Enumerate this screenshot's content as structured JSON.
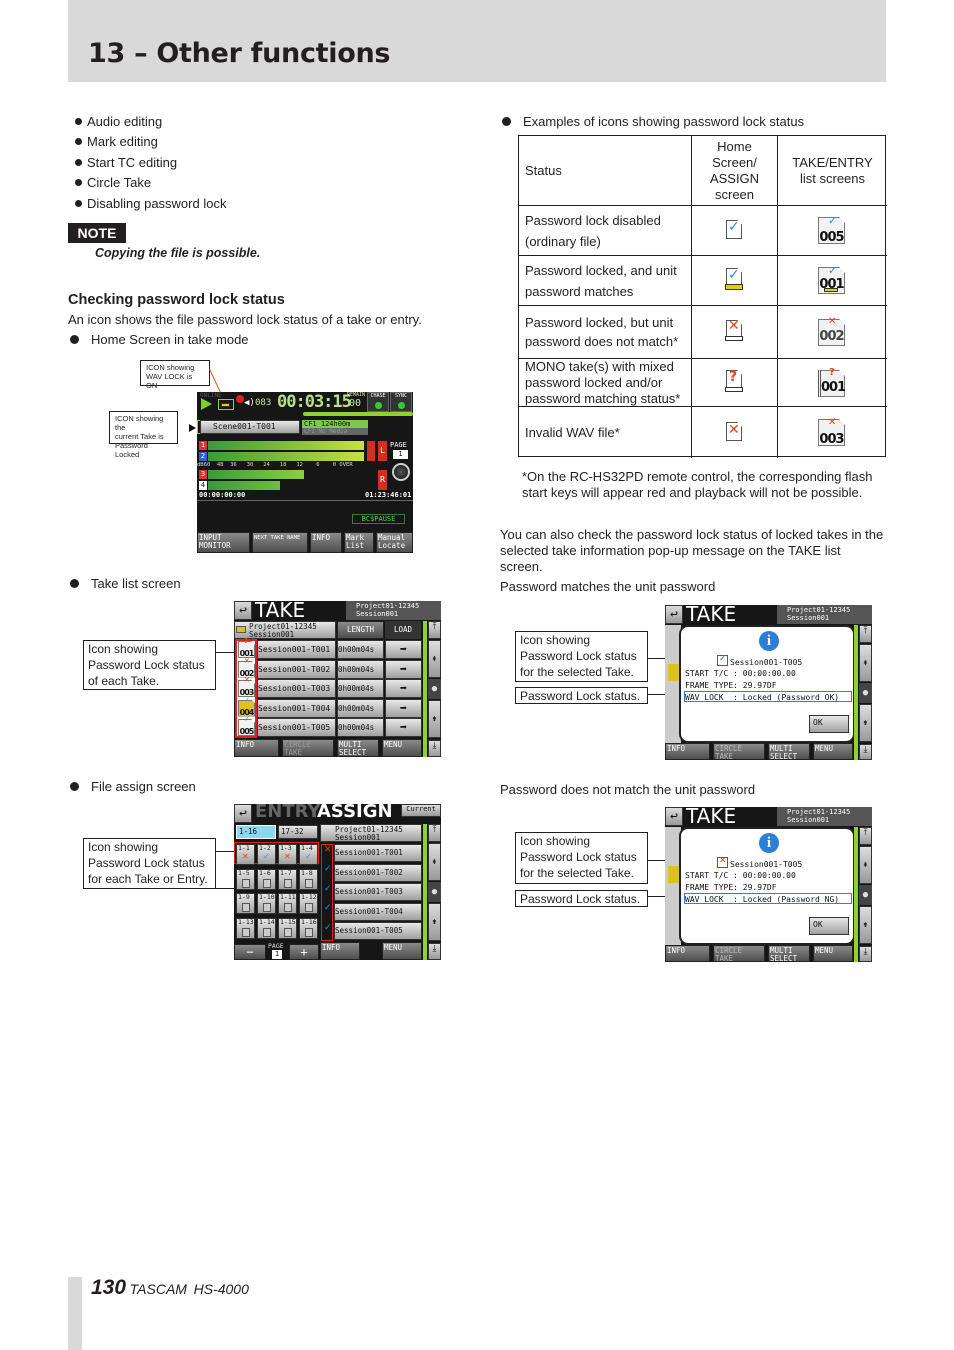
{
  "header": {
    "title": "13 – Other functions"
  },
  "left": {
    "bullets": [
      "Audio editing",
      "Mark editing",
      "Start TC editing",
      "Circle Take",
      "Disabling password lock"
    ],
    "note": {
      "label": "NOTE",
      "text": "Copying the file is possible."
    },
    "checking": {
      "heading": "Checking password lock status",
      "intro": "An icon shows the file password lock status of a take or entry.",
      "home_label": "Home Screen in take mode",
      "take_list_label": "Take list screen",
      "file_assign_label": "File assign screen"
    }
  },
  "home_screen": {
    "callout_wav": "ICON showing\nWAV LOCK is ON",
    "callout_take": "ICON showing the\ncurrent Take is\nPassword Locked",
    "online": "ONLINE",
    "counter": "083",
    "time": "00:03:15",
    "remain": "REMAIN",
    "frames": "00",
    "chase": "CHASE",
    "sync": "SYNC",
    "take_name": "Scene001-T001",
    "cf1": "CF1 124h00m",
    "cf2": "CF2 No Media",
    "channels": [
      "1",
      "2",
      "3",
      "4"
    ],
    "scale": "dB60  48  36   30   24   18   12    6    0 OVER",
    "left_label": "L",
    "right_label": "R",
    "page_label": "PAGE",
    "page_num": "1",
    "tc_start": "00:00:00:00",
    "tc_end": "01:23:46:01",
    "status": "BC$PAUSE",
    "buttons": [
      "INPUT MONITOR",
      "NEXT TAKE NAME",
      "INFO",
      "Mark List",
      "Manual Locate"
    ]
  },
  "take_list": {
    "callout": "Icon showing\nPassword Lock status\nof each Take.",
    "title": "TAKE",
    "project": "Project01-12345",
    "session": "Session001",
    "col_length": "LENGTH",
    "col_load": "LOAD",
    "rows": [
      {
        "num": "001",
        "name": "Session001-T001",
        "length": "0h00m04s",
        "icon": "mixed"
      },
      {
        "num": "002",
        "name": "Session001-T002",
        "length": "0h00m04s",
        "icon": "locked-mismatch"
      },
      {
        "num": "003",
        "name": "Session001-T003",
        "length": "0h00m04s",
        "icon": "invalid"
      },
      {
        "num": "004",
        "name": "Session001-T004",
        "length": "0h00m04s",
        "icon": "selected-locked"
      },
      {
        "num": "005",
        "name": "Session001-T005",
        "length": "0h00m04s",
        "icon": "unlocked"
      }
    ],
    "buttons": [
      "INFO",
      "CIRCLE TAKE",
      "MULTI SELECT",
      "MENU"
    ]
  },
  "assign": {
    "callout": "Icon showing\nPassword Lock status\nfor each Take or Entry.",
    "title_entry": "ENTRY",
    "title_assign": "ASSIGN",
    "current": "Current",
    "tabs": [
      "1-16",
      "17-32"
    ],
    "slots": [
      "1-1",
      "1-2",
      "1-3",
      "1-4",
      "1-5",
      "1-6",
      "1-7",
      "1-8",
      "1-9",
      "1-10",
      "1-11",
      "1-12",
      "1-13",
      "1-14",
      "1-15",
      "1-16"
    ],
    "project": "Project01-12345",
    "session": "Session001",
    "takes": [
      "Session001-T001",
      "Session001-T002",
      "Session001-T003",
      "Session001-T004",
      "Session001-T005"
    ],
    "minus": "−",
    "plus": "+",
    "page_label": "PAGE",
    "page_num": "1",
    "info": "INFO",
    "menu": "MENU"
  },
  "right": {
    "examples_heading": "Examples of icons showing password lock status",
    "table": {
      "headers": [
        "Status",
        "Home Screen/ ASSIGN screen",
        "TAKE/ENTRY list screens"
      ],
      "rows": [
        {
          "status": "Password lock disabled (ordinary file)",
          "num": "005"
        },
        {
          "status": "Password locked, and unit password matches",
          "num": "001"
        },
        {
          "status": "Password locked, but unit password does not match*",
          "num": "002"
        },
        {
          "status": "MONO take(s) with mixed password locked and/or password matching status*",
          "num": "001"
        },
        {
          "status": "Invalid WAV file*",
          "num": "003"
        }
      ]
    },
    "footnote": "*On the RC-HS32PD remote control, the corresponding flash start keys will appear red and playback will not be possible.",
    "para": "You can also check the password lock status of locked takes in the selected take information pop-up message on the TAKE list screen.",
    "match_label": "Password matches the unit password",
    "nomatch_label": "Password does not match the unit password"
  },
  "popup_ok": {
    "callout_icon": "Icon showing\nPassword Lock status\nfor the selected Take.",
    "callout_status": "Password Lock status.",
    "title": "TAKE",
    "project": "Project01-12345",
    "session": "Session001",
    "file": "Session001-T005",
    "start": "START T/C : 00:00:00.00",
    "frame": "FRAME TYPE: 29.97DF",
    "wav": "WAV LOCK  : Locked (Password OK)",
    "ok": "OK",
    "buttons": [
      "INFO",
      "CIRCLE TAKE",
      "MULTI SELECT",
      "MENU"
    ]
  },
  "popup_ng": {
    "callout_icon": "Icon showing\nPassword Lock status\nfor the selected Take.",
    "callout_status": "Password Lock status.",
    "title": "TAKE",
    "project": "Project01-12345",
    "session": "Session001",
    "file": "Session001-T005",
    "start": "START T/C : 00:00:00.00",
    "frame": "FRAME TYPE: 29.97DF",
    "wav": "WAV LOCK  : Locked (Password NG)",
    "ok": "OK",
    "buttons": [
      "INFO",
      "CIRCLE TAKE",
      "MULTI SELECT",
      "MENU"
    ]
  },
  "footer": {
    "page": "130",
    "brand": "TASCAM",
    "model": "HS-4000"
  },
  "colors": {
    "header_band": "#d9d9d9",
    "accent_green": "#8dd32e",
    "check_blue": "#2a8ce0",
    "cross_red": "#e8401c"
  }
}
